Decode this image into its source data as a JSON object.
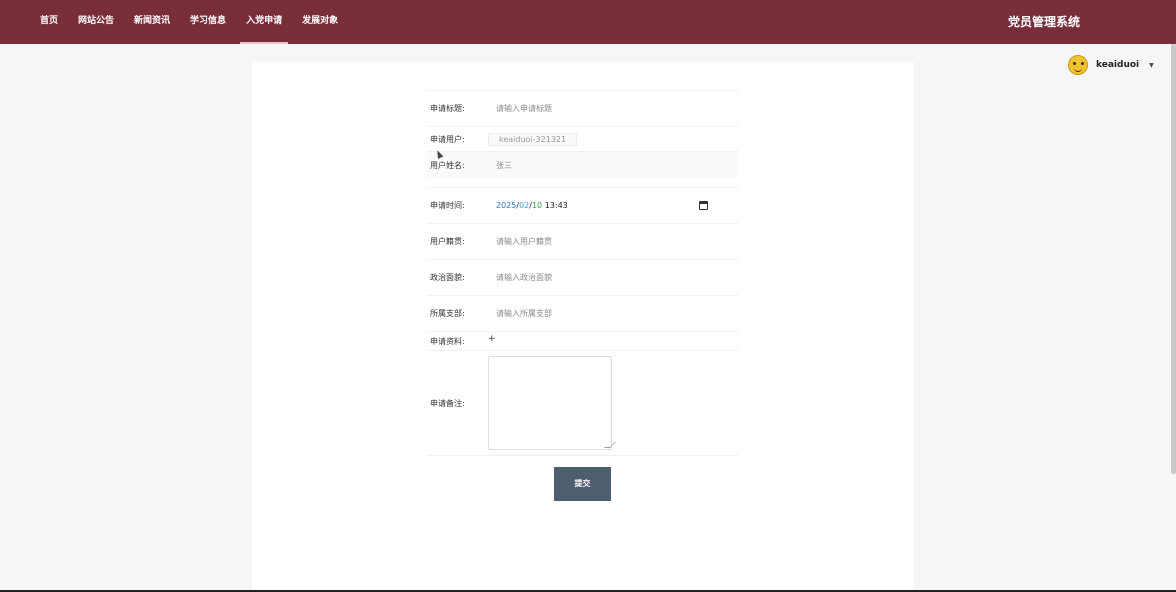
{
  "nav": {
    "items": [
      {
        "label": "首页",
        "active": false
      },
      {
        "label": "网站公告",
        "active": false
      },
      {
        "label": "新闻资讯",
        "active": false
      },
      {
        "label": "学习信息",
        "active": false
      },
      {
        "label": "入党申请",
        "active": true
      },
      {
        "label": "发展对象",
        "active": false
      }
    ],
    "site_title": "党员管理系统"
  },
  "user": {
    "username": "keaiduoi",
    "avatar_icon": "avatar-icon",
    "caret_icon": "caret-down-icon"
  },
  "form": {
    "title": {
      "label": "申请标题:",
      "placeholder": "请输入申请标题"
    },
    "user": {
      "label": "申请用户:",
      "value": "keaiduoi-321321"
    },
    "name": {
      "label": "用户姓名:",
      "value": "张三"
    },
    "time": {
      "label": "申请时间:",
      "year": "2025",
      "month": "02",
      "day": "10",
      "time": "13:43",
      "sep": "/"
    },
    "native": {
      "label": "用户籍贯:",
      "placeholder": "请输入用户籍贯"
    },
    "politics": {
      "label": "政治面貌:",
      "placeholder": "请输入政治面貌"
    },
    "branch": {
      "label": "所属支部:",
      "placeholder": "请输入所属支部"
    },
    "material": {
      "label": "申请资料:",
      "upload_symbol": "+"
    },
    "remark": {
      "label": "申请备注:"
    },
    "submit_label": "提交"
  },
  "colors": {
    "topbar": "#772e38",
    "submit": "#4f5d70"
  }
}
